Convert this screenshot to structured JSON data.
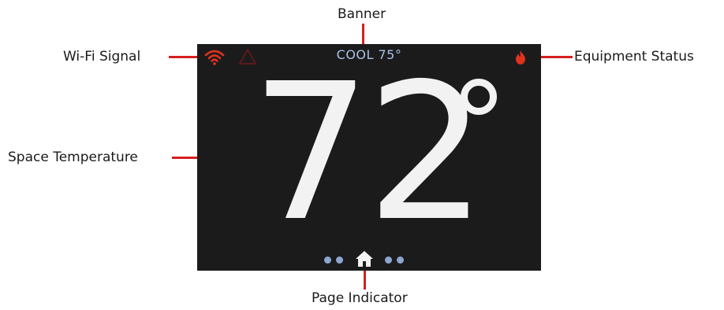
{
  "callouts": {
    "banner": "Banner",
    "wifi": "Wi-Fi Signal",
    "equipment": "Equipment Status",
    "space_temp": "Space Temperature",
    "page_indicator": "Page Indicator"
  },
  "display": {
    "banner_text": "COOL 75°",
    "temperature": "72",
    "icons": [
      "wifi-icon",
      "alert-icon",
      "flame-icon",
      "home-icon"
    ],
    "page_dots": 5,
    "current_page": 3
  },
  "colors": {
    "screen_bg": "#1c1b1c",
    "leader_lines": "#d71f1f",
    "wifi_icon": "#e0321f",
    "alert_icon": "#5a1a1a",
    "flame_icon": "#e0321f",
    "banner_text": "#a9c0e6",
    "temperature": "#f2f2f2",
    "page_dots": "#8ea6cf"
  }
}
